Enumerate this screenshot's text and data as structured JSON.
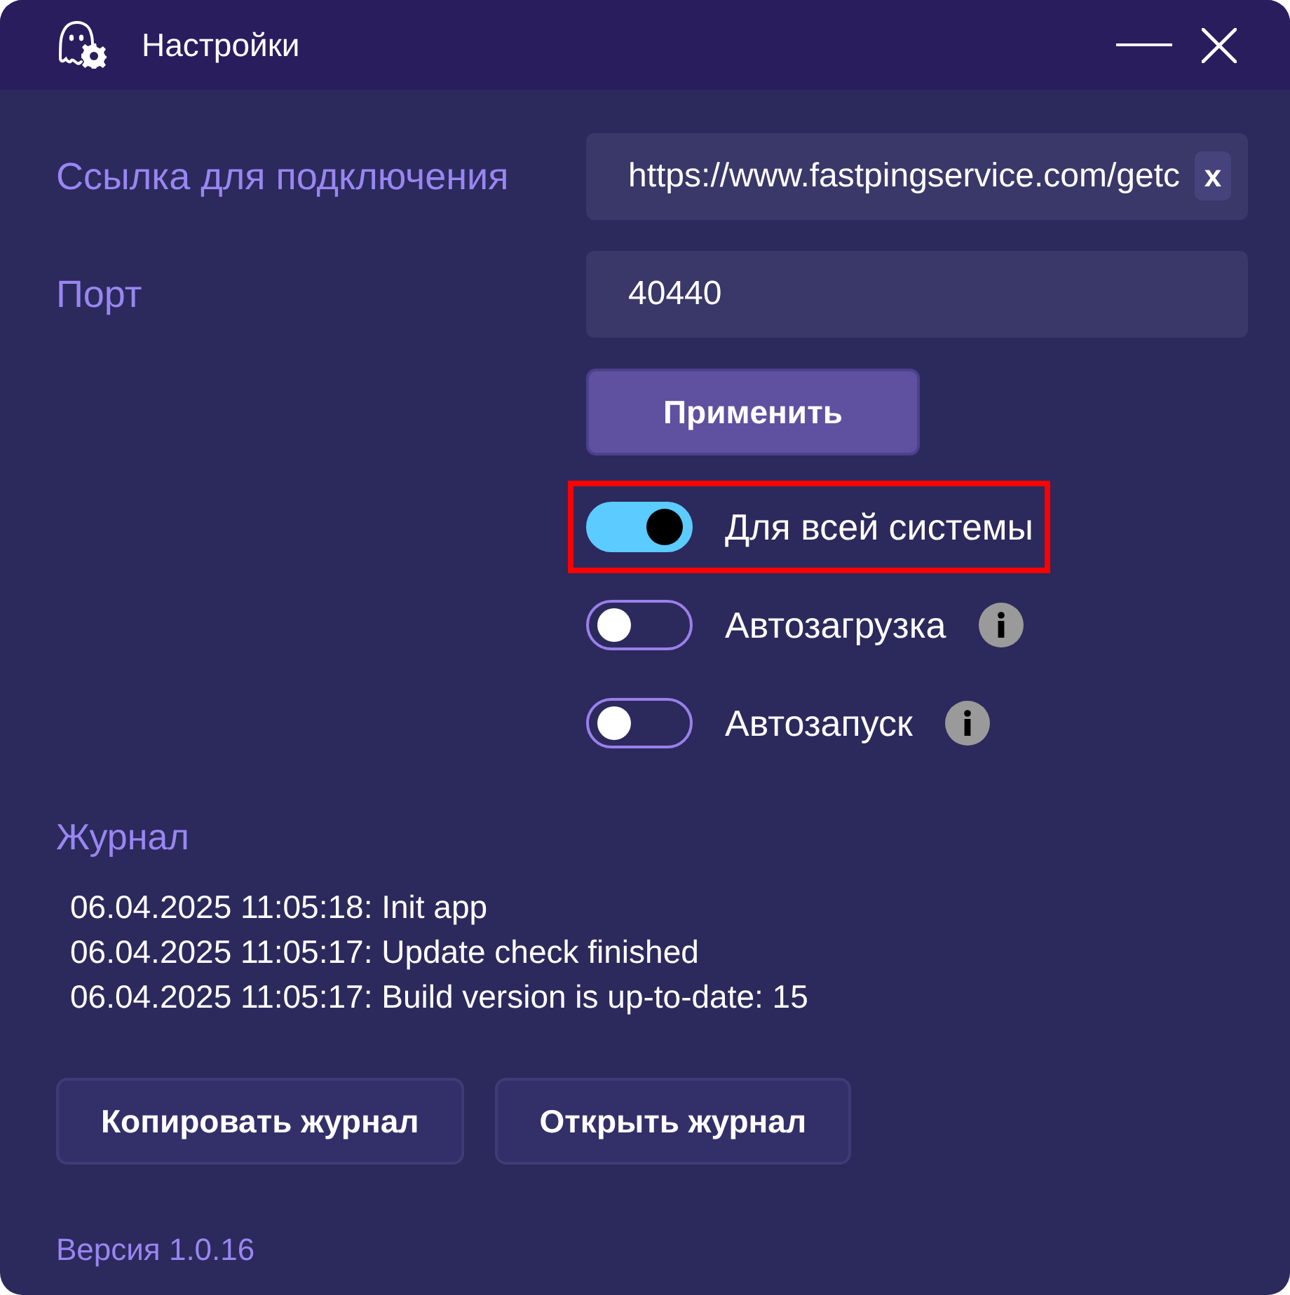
{
  "window": {
    "title": "Настройки"
  },
  "connection": {
    "label": "Ссылка для подключения",
    "value": "https://www.fastpingservice.com/getc",
    "clear_button": "x"
  },
  "port": {
    "label": "Порт",
    "value": "40440"
  },
  "apply_button": "Применить",
  "toggles": [
    {
      "label": "Для всей системы",
      "on": true,
      "info": false,
      "highlighted": true
    },
    {
      "label": "Автозагрузка",
      "on": false,
      "info": true,
      "highlighted": false
    },
    {
      "label": "Автозапуск",
      "on": false,
      "info": true,
      "highlighted": false
    }
  ],
  "log": {
    "title": "Журнал",
    "entries": [
      "06.04.2025 11:05:18: Init app",
      "06.04.2025 11:05:17: Update check finished",
      "06.04.2025 11:05:17: Build version is up-to-date: 15"
    ]
  },
  "log_buttons": [
    "Копировать журнал",
    "Открыть журнал"
  ],
  "version": "Версия 1.0.16"
}
